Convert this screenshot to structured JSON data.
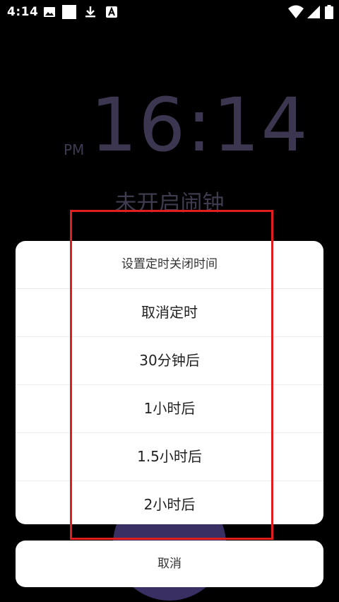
{
  "status_bar": {
    "time": "4:14",
    "left_icons": [
      "image-icon",
      "square-icon",
      "download-icon",
      "text-a-icon"
    ],
    "right_icons": [
      "wifi-icon",
      "signal-icon",
      "battery-icon"
    ]
  },
  "clock": {
    "ampm": "PM",
    "time": "16:14",
    "alarm_status": "未开启闹钟"
  },
  "sheet": {
    "title": "设置定时关闭时间",
    "options": [
      "取消定时",
      "30分钟后",
      "1小时后",
      "1.5小时后",
      "2小时后"
    ]
  },
  "cancel_label": "取消",
  "colors": {
    "background": "#000000",
    "clock_text": "#3d3651",
    "sheet_bg": "#ffffff",
    "highlight": "#e11d1d",
    "accent": "#3a2f63"
  }
}
